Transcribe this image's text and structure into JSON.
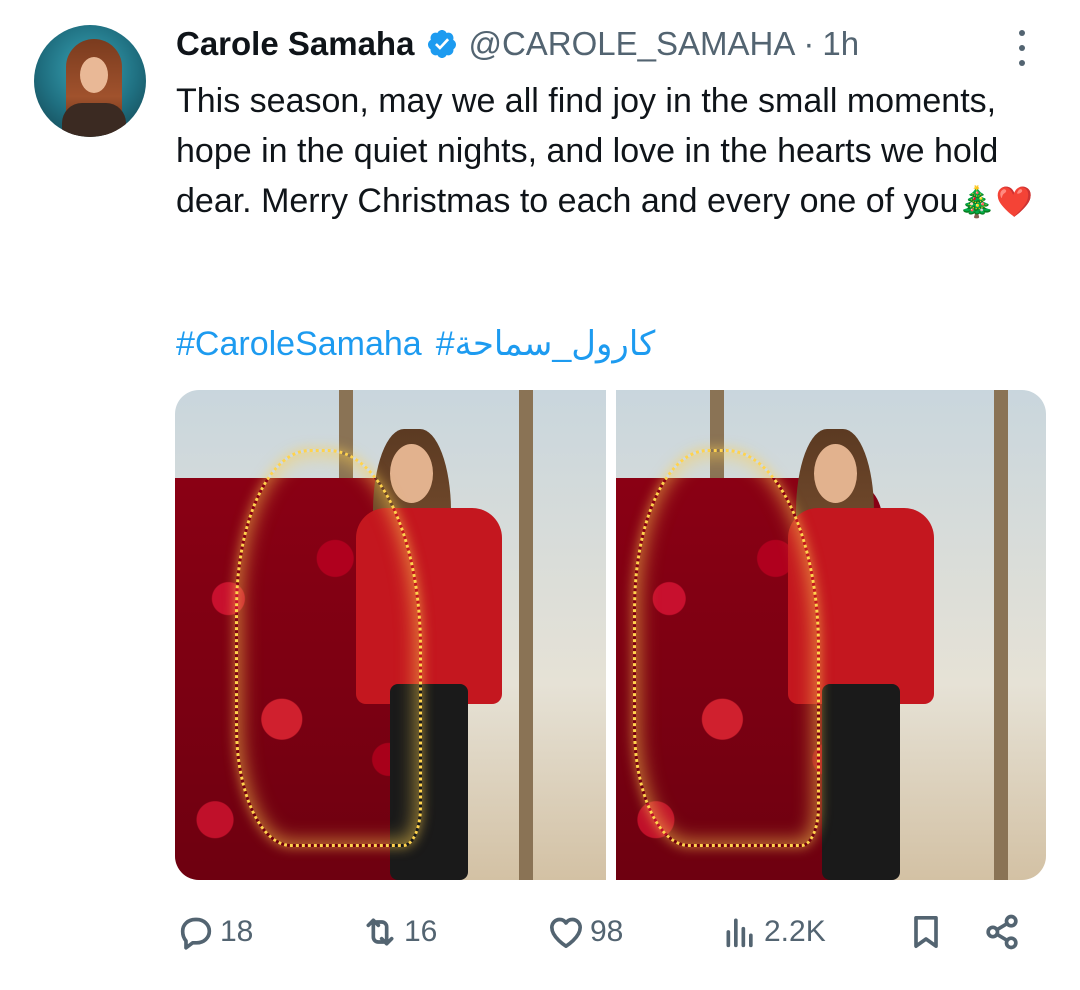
{
  "tweet": {
    "author_name": "Carole Samaha",
    "handle": "@CAROLE_SAMAHA",
    "separator": "·",
    "time": "1h",
    "text": "This season, may we all find joy in the small moments, hope in the quiet nights, and love in the hearts we hold dear. Merry Christmas to each and every one of you",
    "emoji_tree": "🎄",
    "emoji_heart": "❤️",
    "hashtags": [
      "#CaroleSamaha",
      "#كارول_سماحة"
    ]
  },
  "actions": {
    "replies": "18",
    "retweets": "16",
    "likes": "98",
    "views": "2.2K"
  },
  "colors": {
    "accent": "#1d9bf0",
    "secondary_text": "#536471",
    "primary_text": "#0f1419"
  },
  "icons": [
    "verified-badge-icon",
    "more-options-icon",
    "reply-icon",
    "retweet-icon",
    "like-icon",
    "views-icon",
    "bookmark-icon",
    "share-icon"
  ]
}
